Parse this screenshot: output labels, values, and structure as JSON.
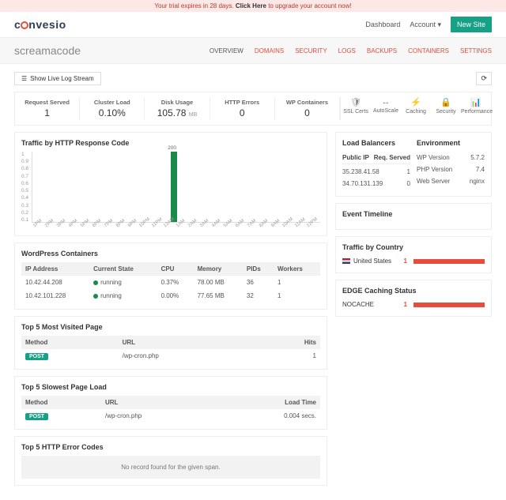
{
  "trial": {
    "prefix": "Your trial expires in 28 days. ",
    "click": "Click Here",
    "suffix": " to upgrade your account now!"
  },
  "brand": "convesio",
  "nav": {
    "dashboard": "Dashboard",
    "account": "Account",
    "newSite": "New Site"
  },
  "siteName": "screamacode",
  "tabs": [
    "OVERVIEW",
    "DOMAINS",
    "SECURITY",
    "LOGS",
    "BACKUPS",
    "CONTAINERS",
    "SETTINGS"
  ],
  "logBtn": "Show Live Log Stream",
  "stats": {
    "requestServed": {
      "lbl": "Request Served",
      "val": "1"
    },
    "clusterLoad": {
      "lbl": "Cluster Load",
      "val": "0.10%"
    },
    "diskUsage": {
      "lbl": "Disk Usage",
      "val": "105.78",
      "unit": "MB"
    },
    "httpErrors": {
      "lbl": "HTTP Errors",
      "val": "0"
    },
    "wpContainers": {
      "lbl": "WP Containers",
      "val": "0"
    }
  },
  "quick": [
    {
      "icon": "🛡",
      "lbl": "SSL Certs"
    },
    {
      "icon": "↔",
      "lbl": "AutoScale"
    },
    {
      "icon": "⚡",
      "lbl": "Caching"
    },
    {
      "icon": "🔒",
      "lbl": "Security"
    },
    {
      "icon": "📊",
      "lbl": "Performance"
    }
  ],
  "chartTitle": "Traffic by HTTP Response Code",
  "chart_data": {
    "type": "bar",
    "title": "Traffic by HTTP Response Code",
    "ylabel": "",
    "xlabel": "",
    "ylim": [
      0,
      1.0
    ],
    "yticks": [
      1.0,
      0.9,
      0.8,
      0.7,
      0.6,
      0.5,
      0.4,
      0.3,
      0.2,
      0.1
    ],
    "categories": [
      "1PM",
      "2PM",
      "3PM",
      "4PM",
      "5PM",
      "6PM",
      "7PM",
      "8PM",
      "9PM",
      "10PM",
      "11PM",
      "12AM",
      "1AM",
      "2AM",
      "3AM",
      "4AM",
      "5AM",
      "6AM",
      "7AM",
      "8AM",
      "9AM",
      "10AM",
      "11AM",
      "12PM"
    ],
    "series": [
      {
        "name": "200",
        "values": [
          0,
          0,
          0,
          0,
          0,
          0,
          0,
          0,
          0,
          0,
          0,
          1,
          0,
          0,
          0,
          0,
          0,
          0,
          0,
          0,
          0,
          0,
          0,
          0
        ]
      }
    ],
    "barLabel": "200"
  },
  "wpc": {
    "title": "WordPress Containers",
    "headers": [
      "IP Address",
      "Current State",
      "CPU",
      "Memory",
      "PIDs",
      "Workers"
    ],
    "rows": [
      {
        "ip": "10.42.44.208",
        "state": "running",
        "cpu": "0.37%",
        "mem": "78.00 MB",
        "pids": "36",
        "workers": "1"
      },
      {
        "ip": "10.42.101.228",
        "state": "running",
        "cpu": "0.00%",
        "mem": "77.65 MB",
        "pids": "32",
        "workers": "1"
      }
    ]
  },
  "visited": {
    "title": "Top 5 Most Visited Page",
    "headers": [
      "Method",
      "URL",
      "Hits"
    ],
    "rows": [
      {
        "method": "POST",
        "url": "/wp-cron.php",
        "hits": "1"
      }
    ]
  },
  "slowest": {
    "title": "Top 5 Slowest Page Load",
    "headers": [
      "Method",
      "URL",
      "Load Time"
    ],
    "rows": [
      {
        "method": "POST",
        "url": "/wp-cron.php",
        "time": "0.004 secs."
      }
    ]
  },
  "errors": {
    "title": "Top 5 HTTP Error Codes",
    "empty": "No record found for the given span."
  },
  "lb": {
    "title": "Load Balancers",
    "headers": [
      "Public IP",
      "Req. Served"
    ],
    "rows": [
      {
        "ip": "35.238.41.58",
        "req": "1"
      },
      {
        "ip": "34.70.131.139",
        "req": "0"
      }
    ]
  },
  "env": {
    "title": "Environment",
    "rows": [
      {
        "k": "WP Version",
        "v": "5.7.2"
      },
      {
        "k": "PHP Version",
        "v": "7.4"
      },
      {
        "k": "Web Server",
        "v": "nginx"
      }
    ]
  },
  "timeline": {
    "title": "Event Timeline"
  },
  "country": {
    "title": "Traffic by Country",
    "rows": [
      {
        "name": "United States",
        "count": "1"
      }
    ]
  },
  "edge": {
    "title": "EDGE Caching Status",
    "rows": [
      {
        "name": "NOCACHE",
        "count": "1"
      }
    ]
  }
}
